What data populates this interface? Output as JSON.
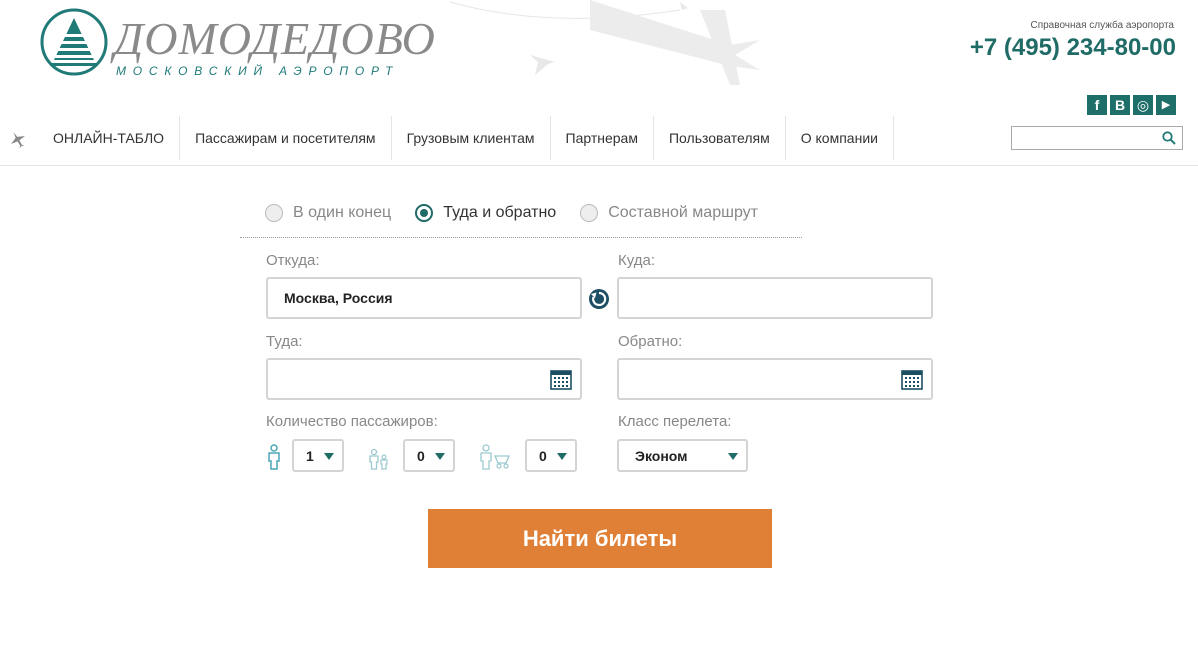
{
  "header": {
    "logo_title": "ДОМОДЕДОВО",
    "logo_subtitle": "МОСКОВСКИЙ АЭРОПОРТ",
    "help_label": "Справочная служба аэропорта",
    "help_phone": "+7 (495) 234-80-00",
    "social": [
      {
        "icon": "facebook-icon",
        "glyph": "f"
      },
      {
        "icon": "vk-icon",
        "glyph": "B"
      },
      {
        "icon": "instagram-icon",
        "glyph": "◎"
      },
      {
        "icon": "youtube-icon",
        "glyph": "▶"
      }
    ]
  },
  "nav": {
    "items": [
      {
        "label": "ОНЛАЙН-ТАБЛО"
      },
      {
        "label": "Пассажирам и посетителям"
      },
      {
        "label": "Грузовым клиентам"
      },
      {
        "label": "Партнерам"
      },
      {
        "label": "Пользователям"
      },
      {
        "label": "О компании"
      }
    ],
    "search": {
      "value": "",
      "placeholder": ""
    }
  },
  "form": {
    "trip_types": [
      {
        "label": "В один конец",
        "selected": false
      },
      {
        "label": "Туда и обратно",
        "selected": true
      },
      {
        "label": "Составной маршрут",
        "selected": false
      }
    ],
    "from_label": "Откуда:",
    "from_value": "Москва, Россия",
    "to_label": "Куда:",
    "to_value": "",
    "depart_label": "Туда:",
    "depart_value": "",
    "return_label": "Обратно:",
    "return_value": "",
    "passengers_label": "Количество пассажиров:",
    "adults": "1",
    "children": "0",
    "infants": "0",
    "class_label": "Класс перелета:",
    "class_value": "Эконом",
    "submit_label": "Найти билеты"
  },
  "colors": {
    "brand_teal": "#1f6b66",
    "accent_orange": "#e07f36"
  }
}
